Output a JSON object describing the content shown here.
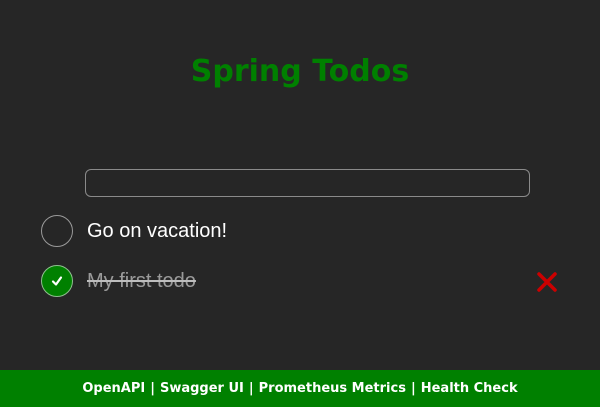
{
  "app": {
    "title": "Spring Todos"
  },
  "new_todo": {
    "value": "",
    "placeholder": ""
  },
  "todos": [
    {
      "label": "Go on vacation!",
      "completed": false
    },
    {
      "label": "My first todo",
      "completed": true
    }
  ],
  "icons": {
    "check": "check-icon",
    "delete": "close-icon"
  },
  "colors": {
    "background": "#262626",
    "accent": "#008000",
    "delete": "#cc0000",
    "completed_text": "#9a9a9a"
  },
  "footer": {
    "links": [
      {
        "label": "OpenAPI"
      },
      {
        "label": "Swagger UI"
      },
      {
        "label": "Prometheus Metrics"
      },
      {
        "label": "Health Check"
      }
    ],
    "separator": "|"
  }
}
